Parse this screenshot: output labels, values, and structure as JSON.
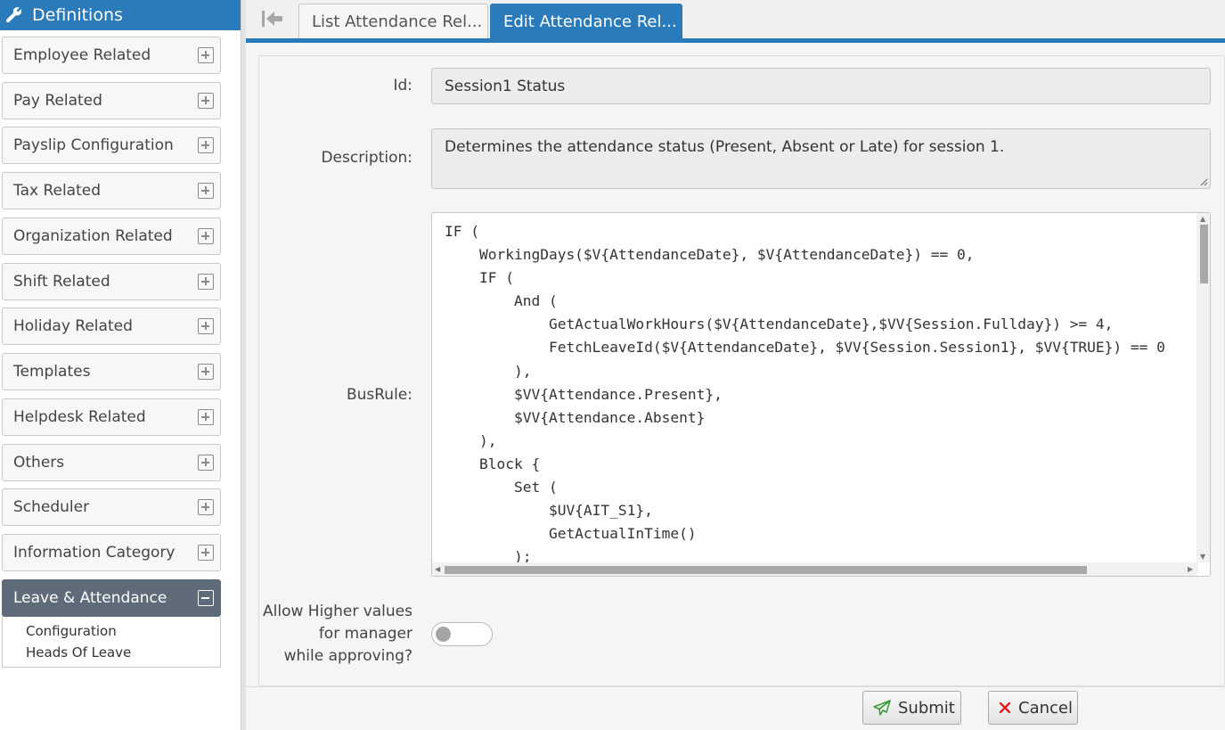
{
  "sidebar": {
    "title": "Definitions",
    "items": [
      {
        "label": "Employee Related"
      },
      {
        "label": "Pay Related"
      },
      {
        "label": "Payslip Configuration"
      },
      {
        "label": "Tax Related"
      },
      {
        "label": "Organization Related"
      },
      {
        "label": "Shift Related"
      },
      {
        "label": "Holiday Related"
      },
      {
        "label": "Templates"
      },
      {
        "label": "Helpdesk Related"
      },
      {
        "label": "Others"
      },
      {
        "label": "Scheduler"
      },
      {
        "label": "Information Category"
      },
      {
        "label": "Leave & Attendance"
      }
    ],
    "sub_items": [
      "Configuration",
      "Heads Of Leave"
    ]
  },
  "tabs": [
    {
      "label": "List Attendance Rel..."
    },
    {
      "label": "Edit Attendance Rel..."
    }
  ],
  "form": {
    "id_label": "Id:",
    "id_value": "Session1 Status",
    "description_label": "Description:",
    "description_value": "Determines the attendance status (Present, Absent or Late) for session 1.",
    "busrule_label": "BusRule:",
    "busrule_code": "IF (\n    WorkingDays($V{AttendanceDate}, $V{AttendanceDate}) == 0,\n    IF (\n        And (\n            GetActualWorkHours($V{AttendanceDate},$VV{Session.Fullday}) >= 4,\n            FetchLeaveId($V{AttendanceDate}, $VV{Session.Session1}, $VV{TRUE}) == 0\n        ),\n        $VV{Attendance.Present},\n        $VV{Attendance.Absent}\n    ),\n    Block {\n        Set (\n            $UV{AIT_S1},\n            GetActualInTime()\n        );",
    "allow_label_1": "Allow Higher values",
    "allow_label_2": "for manager",
    "allow_label_3": "while approving?",
    "allow_value": false
  },
  "footer": {
    "submit_label": "Submit",
    "cancel_label": "Cancel"
  },
  "colors": {
    "accent": "#2b7ab9",
    "active_item": "#5f6b78",
    "submit_icon": "#3a9d3a",
    "cancel_icon": "#e02020"
  }
}
